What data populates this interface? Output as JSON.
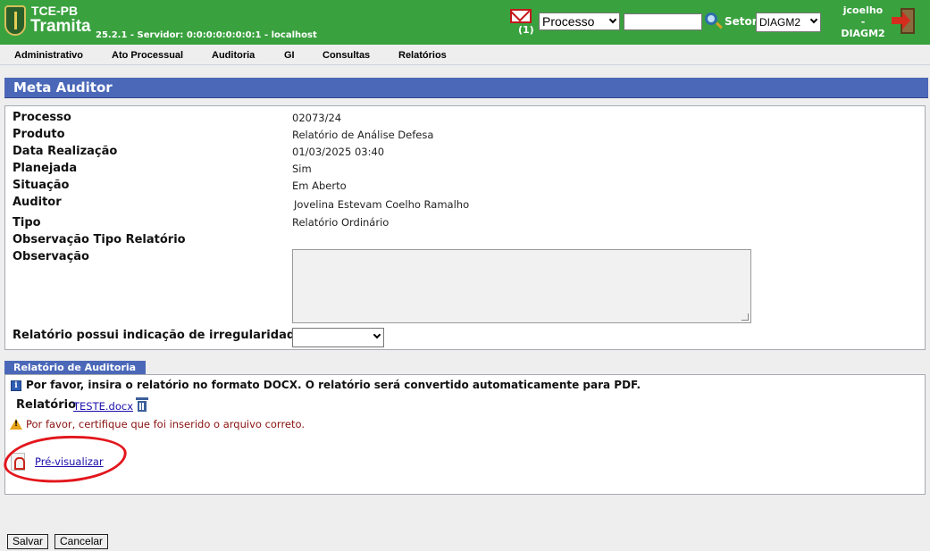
{
  "header": {
    "org": "TCE-PB",
    "app_name": "Tramita",
    "version": "25.2.1 - Servidor: 0:0:0:0:0:0:0:1 - localhost",
    "mail_count": "(1)",
    "search_type": "Processo",
    "search_value": "",
    "setor_label": "Setor",
    "setor_value": "DIAGM2",
    "user": "jcoelho",
    "user_sep": "-",
    "user_setor": "DIAGM2"
  },
  "menu": {
    "items": [
      "Administrativo",
      "Ato Processual",
      "Auditoria",
      "GI",
      "Consultas",
      "Relatórios"
    ]
  },
  "page": {
    "title": "Meta Auditor"
  },
  "form": {
    "fields": [
      {
        "label": "Processo",
        "value": "02073/24"
      },
      {
        "label": "Produto",
        "value": "Relatório de Análise Defesa"
      },
      {
        "label": "Data Realização",
        "value": "01/03/2025 03:40"
      },
      {
        "label": "Planejada",
        "value": "Sim"
      },
      {
        "label": "Situação",
        "value": "Em Aberto"
      },
      {
        "label": "Auditor",
        "value": "Jovelina Estevam Coelho Ramalho"
      },
      {
        "label": "Tipo",
        "value": "Relatório Ordinário"
      },
      {
        "label": "Observação Tipo Relatório",
        "value": ""
      },
      {
        "label": "Observação",
        "value": ""
      }
    ],
    "irregularity_label": "Relatório possui indicação de irregularidade?",
    "irregularity_value": ""
  },
  "report": {
    "tab_label": "Relatório de Auditoria",
    "info_text": "Por favor, insira o relatório no formato DOCX. O relatório será convertido automaticamente para PDF.",
    "file_label": "Relatório",
    "file_name": "TESTE.docx",
    "warning_text": "Por favor, certifique que foi inserido o arquivo correto.",
    "preview_label": "Pré-visualizar"
  },
  "buttons": {
    "save": "Salvar",
    "cancel": "Cancelar"
  },
  "colors": {
    "header_green": "#3aa13f",
    "title_blue": "#4b68b8",
    "annotation_red": "#e2161c"
  }
}
